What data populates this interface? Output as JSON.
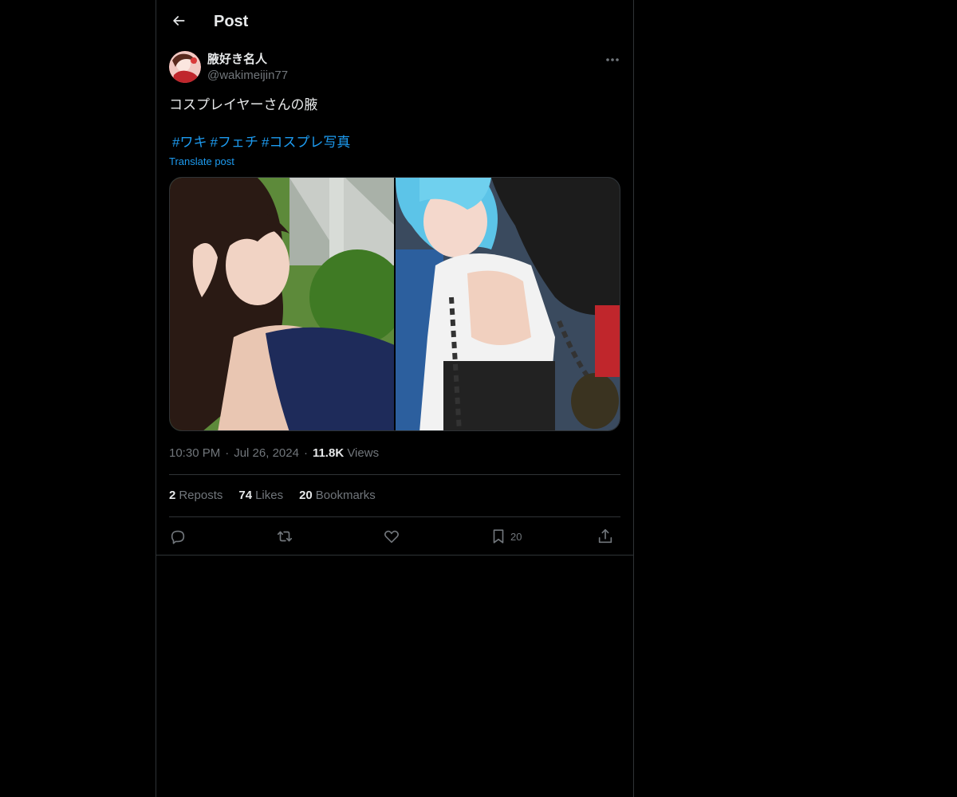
{
  "header": {
    "title": "Post"
  },
  "author": {
    "display_name": "腋好き名人",
    "handle": "@wakimeijin77"
  },
  "post": {
    "text": "コスプレイヤーさんの腋",
    "hashtags": [
      "#ワキ",
      "#フェチ",
      "#コスプレ写真"
    ],
    "translate_label": "Translate post",
    "time": "10:30 PM",
    "date": "Jul 26, 2024",
    "views_count": "11.8K",
    "views_label": "Views",
    "separator": "·"
  },
  "stats": {
    "reposts_count": "2",
    "reposts_label": "Reposts",
    "likes_count": "74",
    "likes_label": "Likes",
    "bookmarks_count": "20",
    "bookmarks_label": "Bookmarks"
  },
  "actions": {
    "bookmark_count": "20",
    "icons": [
      "reply-icon",
      "repost-icon",
      "like-icon",
      "bookmark-icon",
      "share-icon"
    ]
  },
  "colors": {
    "background": "#000000",
    "text": "#e7e9ea",
    "muted": "#71767b",
    "accent": "#1d9bf0",
    "border": "#2f3336"
  }
}
